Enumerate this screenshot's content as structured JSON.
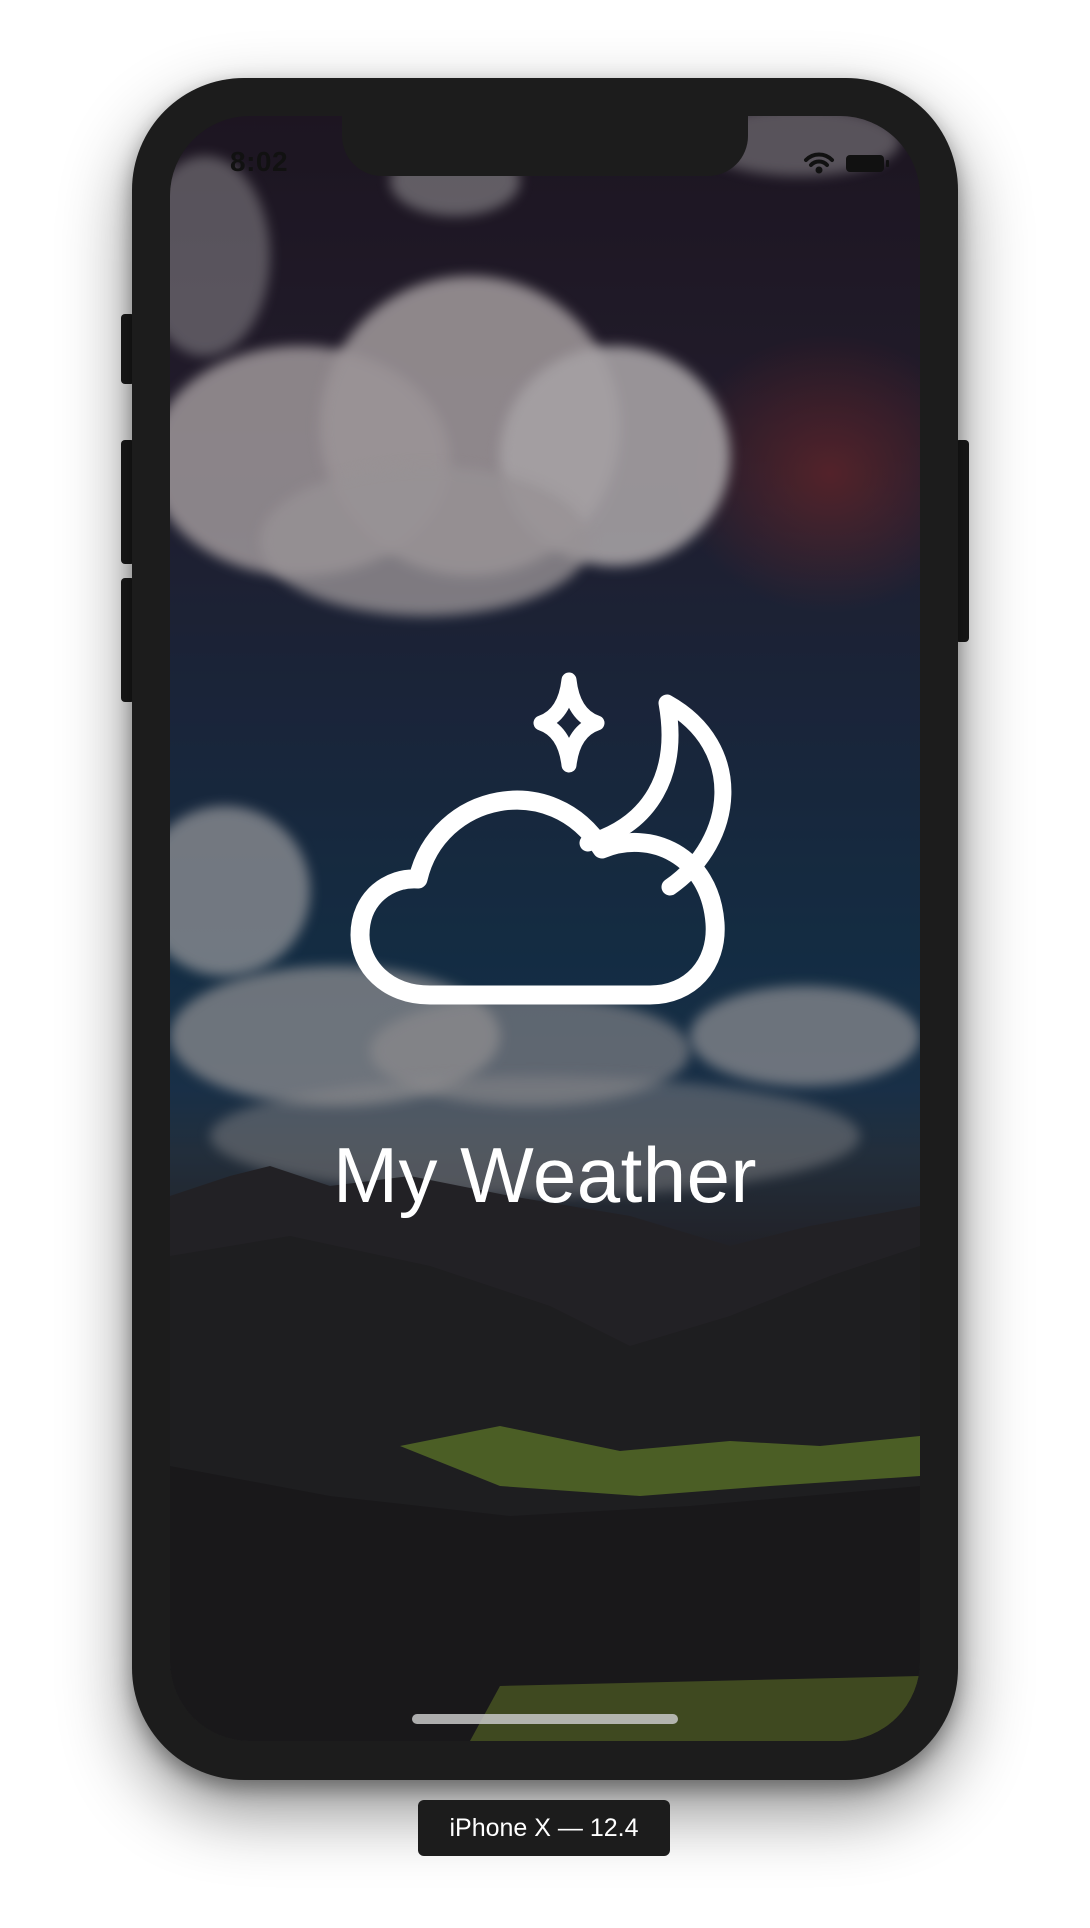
{
  "status_bar": {
    "time": "8:02",
    "wifi_icon": "wifi-icon",
    "battery_icon": "battery-icon"
  },
  "app": {
    "icon": "cloud-moon-star-icon",
    "title": "My Weather",
    "background": "sky-clouds-mountains-photo"
  },
  "simulator": {
    "device_label": "iPhone X — 12.4"
  },
  "colors": {
    "frame": "#1c1c1c",
    "title_text": "#ffffff"
  }
}
